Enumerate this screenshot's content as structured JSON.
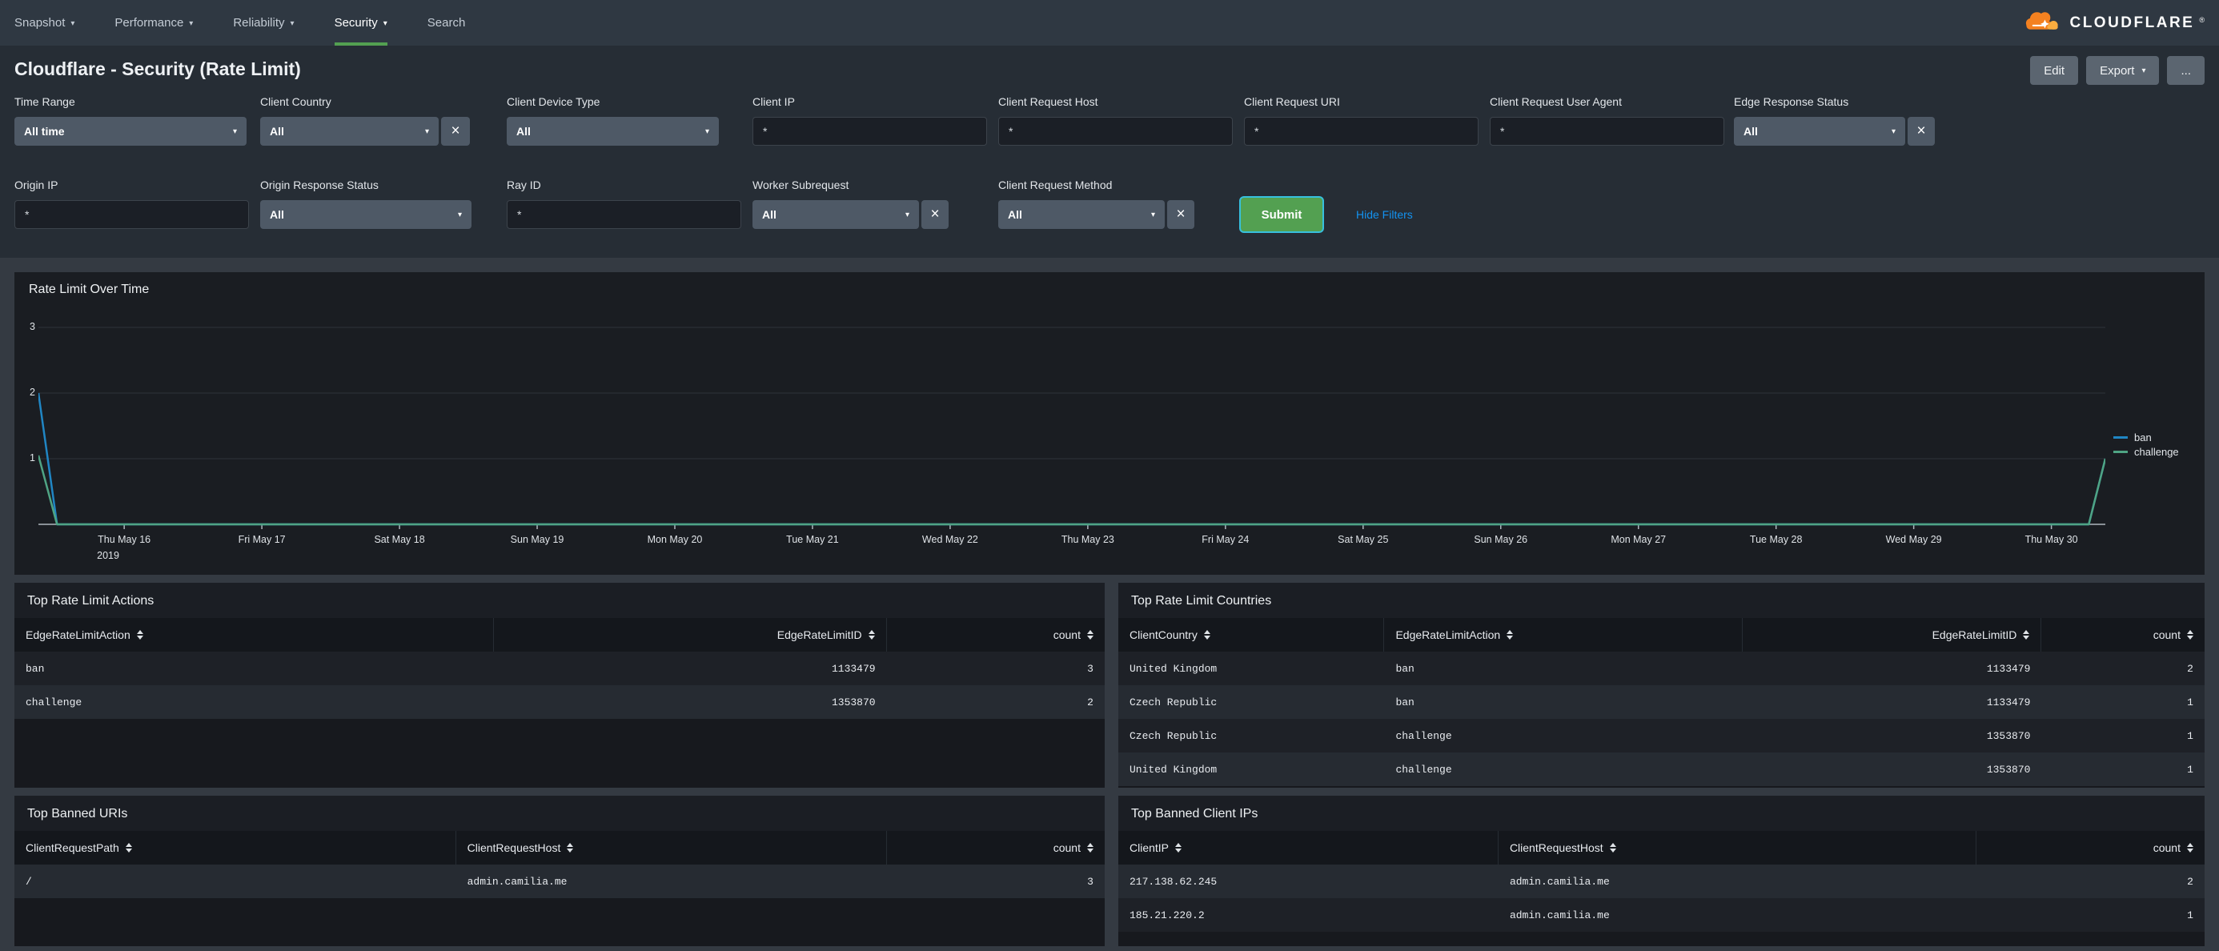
{
  "nav": {
    "items": [
      {
        "label": "Snapshot",
        "caret": true,
        "active": false
      },
      {
        "label": "Performance",
        "caret": true,
        "active": false
      },
      {
        "label": "Reliability",
        "caret": true,
        "active": false
      },
      {
        "label": "Security",
        "caret": true,
        "active": true
      },
      {
        "label": "Search",
        "caret": false,
        "active": false
      }
    ],
    "brand": "CLOUDFLARE",
    "brand_mark": "®"
  },
  "header": {
    "title": "Cloudflare - Security (Rate Limit)",
    "edit_label": "Edit",
    "export_label": "Export",
    "more_label": "..."
  },
  "filters": {
    "row1": [
      {
        "label": "Time Range",
        "type": "dropdown",
        "value": "All time",
        "clearable": false
      },
      {
        "label": "Client Country",
        "type": "dropdown",
        "value": "All",
        "clearable": true
      },
      {
        "label": "Client Device Type",
        "type": "dropdown",
        "value": "All",
        "clearable": false
      },
      {
        "label": "Client IP",
        "type": "text",
        "value": "*"
      },
      {
        "label": "Client Request Host",
        "type": "text",
        "value": "*"
      },
      {
        "label": "Client Request URI",
        "type": "text",
        "value": "*"
      },
      {
        "label": "Client Request User Agent",
        "type": "text",
        "value": "*"
      },
      {
        "label": "Edge Response Status",
        "type": "dropdown",
        "value": "All",
        "clearable": true
      }
    ],
    "row2": [
      {
        "label": "Origin IP",
        "type": "text",
        "value": "*"
      },
      {
        "label": "Origin Response Status",
        "type": "dropdown",
        "value": "All",
        "clearable": false
      },
      {
        "label": "Ray ID",
        "type": "text",
        "value": "*"
      },
      {
        "label": "Worker Subrequest",
        "type": "dropdown",
        "value": "All",
        "clearable": true
      },
      {
        "label": "Client Request Method",
        "type": "dropdown",
        "value": "All",
        "clearable": true
      }
    ],
    "submit_label": "Submit",
    "hide_filters_label": "Hide Filters"
  },
  "chart_data": {
    "type": "line",
    "title": "Rate Limit Over Time",
    "x_tick_labels": [
      "Thu May 16",
      "Fri May 17",
      "Sat May 18",
      "Sun May 19",
      "Mon May 20",
      "Tue May 21",
      "Wed May 22",
      "Thu May 23",
      "Fri May 24",
      "Sat May 25",
      "Sun May 26",
      "Mon May 27",
      "Tue May 28",
      "Wed May 29",
      "Thu May 30"
    ],
    "x_first_tick_sublabel": "2019",
    "ylim": [
      0,
      3
    ],
    "yticks": [
      1,
      2,
      3
    ],
    "legend_position": "right",
    "series": [
      {
        "name": "ban",
        "color": "#2086c4",
        "points": [
          [
            0,
            2
          ],
          [
            0.009,
            0
          ],
          [
            0.992,
            0
          ],
          [
            1,
            1
          ]
        ]
      },
      {
        "name": "challenge",
        "color": "#4fa484",
        "points": [
          [
            0,
            1.05
          ],
          [
            0.009,
            0
          ],
          [
            0.992,
            0
          ],
          [
            1,
            1
          ]
        ]
      }
    ]
  },
  "tables": [
    {
      "title": "Top Rate Limit Actions",
      "columns": [
        {
          "label": "EdgeRateLimitAction",
          "align": "left"
        },
        {
          "label": "EdgeRateLimitID",
          "align": "right"
        },
        {
          "label": "count",
          "align": "right"
        }
      ],
      "rows": [
        [
          "ban",
          "1133479",
          "3"
        ],
        [
          "challenge",
          "1353870",
          "2"
        ]
      ]
    },
    {
      "title": "Top Rate Limit Countries",
      "columns": [
        {
          "label": "ClientCountry",
          "align": "left"
        },
        {
          "label": "EdgeRateLimitAction",
          "align": "left"
        },
        {
          "label": "EdgeRateLimitID",
          "align": "right"
        },
        {
          "label": "count",
          "align": "right"
        }
      ],
      "rows": [
        [
          "United Kingdom",
          "ban",
          "1133479",
          "2"
        ],
        [
          "Czech Republic",
          "ban",
          "1133479",
          "1"
        ],
        [
          "Czech Republic",
          "challenge",
          "1353870",
          "1"
        ],
        [
          "United Kingdom",
          "challenge",
          "1353870",
          "1"
        ]
      ]
    },
    {
      "title": "Top Banned URIs",
      "columns": [
        {
          "label": "ClientRequestPath",
          "align": "left"
        },
        {
          "label": "ClientRequestHost",
          "align": "left"
        },
        {
          "label": "count",
          "align": "right"
        }
      ],
      "rows": [
        [
          "/",
          "admin.camilia.me",
          "3"
        ]
      ]
    },
    {
      "title": "Top Banned Client IPs",
      "columns": [
        {
          "label": "ClientIP",
          "align": "left"
        },
        {
          "label": "ClientRequestHost",
          "align": "left"
        },
        {
          "label": "count",
          "align": "right"
        }
      ],
      "rows": [
        [
          "217.138.62.245",
          "admin.camilia.me",
          "2"
        ],
        [
          "185.21.220.2",
          "admin.camilia.me",
          "1"
        ]
      ]
    }
  ],
  "colors": {
    "accent_green": "#53a051",
    "link_blue": "#1392f0",
    "brand_orange": "#f48120",
    "brand_orange_light": "#faad3f"
  }
}
